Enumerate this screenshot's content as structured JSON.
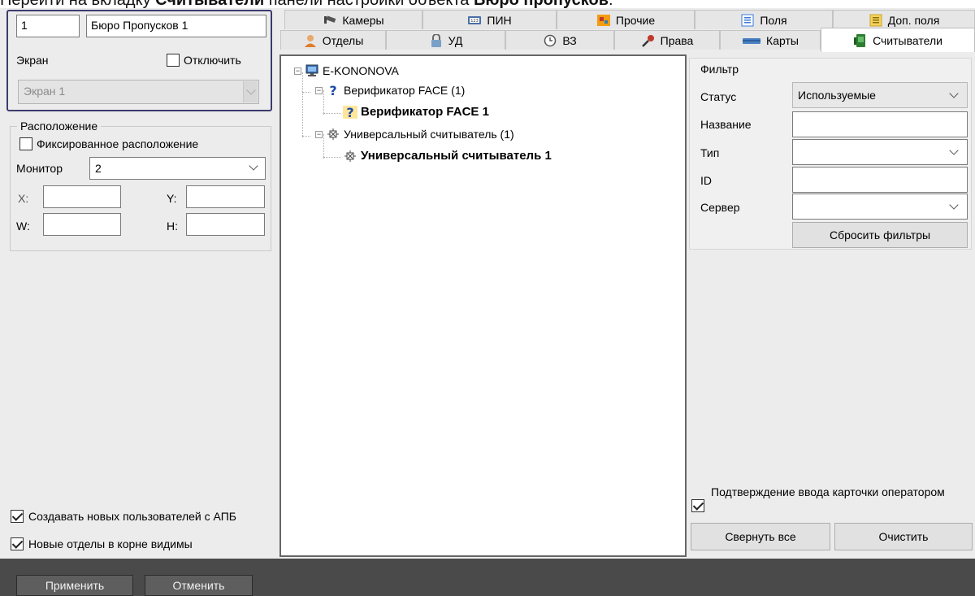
{
  "caption": {
    "prefix": "Перейти на вкладку ",
    "tab_name": "Считыватели",
    "middle": " панели настройки объекта ",
    "object_name": "Бюро пропусков",
    "suffix": "."
  },
  "object": {
    "id": "1",
    "name": "Бюро Пропусков 1"
  },
  "screen": {
    "label": "Экран",
    "disable_label": "Отключить",
    "value": "Экран 1"
  },
  "location": {
    "title": "Расположение",
    "fixed_label": "Фиксированное расположение",
    "monitor_label": "Монитор",
    "monitor_value": "2",
    "x_label": "X:",
    "y_label": "Y:",
    "w_label": "W:",
    "h_label": "H:",
    "x_value": "",
    "y_value": "",
    "w_value": "",
    "h_value": ""
  },
  "left_options": {
    "create_users_apb": "Создавать новых пользователей с АПБ",
    "new_depts_root": "Новые отделы в корне видимы"
  },
  "tabs": {
    "row1": [
      "Камеры",
      "ПИН",
      "Прочие",
      "Поля",
      "Доп. поля"
    ],
    "row2": [
      "Отделы",
      "УД",
      "ВЗ",
      "Права",
      "Карты",
      "Считыватели"
    ]
  },
  "tree": {
    "root": "E-KONONOVA",
    "face_group": "Верификатор FACE (1)",
    "face_item": "Верификатор FACE 1",
    "universal_group": "Универсальный считыватель (1)",
    "universal_item": "Универсальный считыватель 1"
  },
  "filter": {
    "title": "Фильтр",
    "status_label": "Статус",
    "status_value": "Используемые",
    "name_label": "Название",
    "name_value": "",
    "type_label": "Тип",
    "type_value": "",
    "id_label": "ID",
    "id_value": "",
    "server_label": "Сервер",
    "server_value": "",
    "reset_button": "Сбросить фильтры"
  },
  "confirm_card_label": "Подтверждение ввода карточки оператором",
  "collapse_button": "Свернуть все",
  "clear_button": "Очистить",
  "apply_button": "Применить",
  "cancel_button": "Отменить"
}
